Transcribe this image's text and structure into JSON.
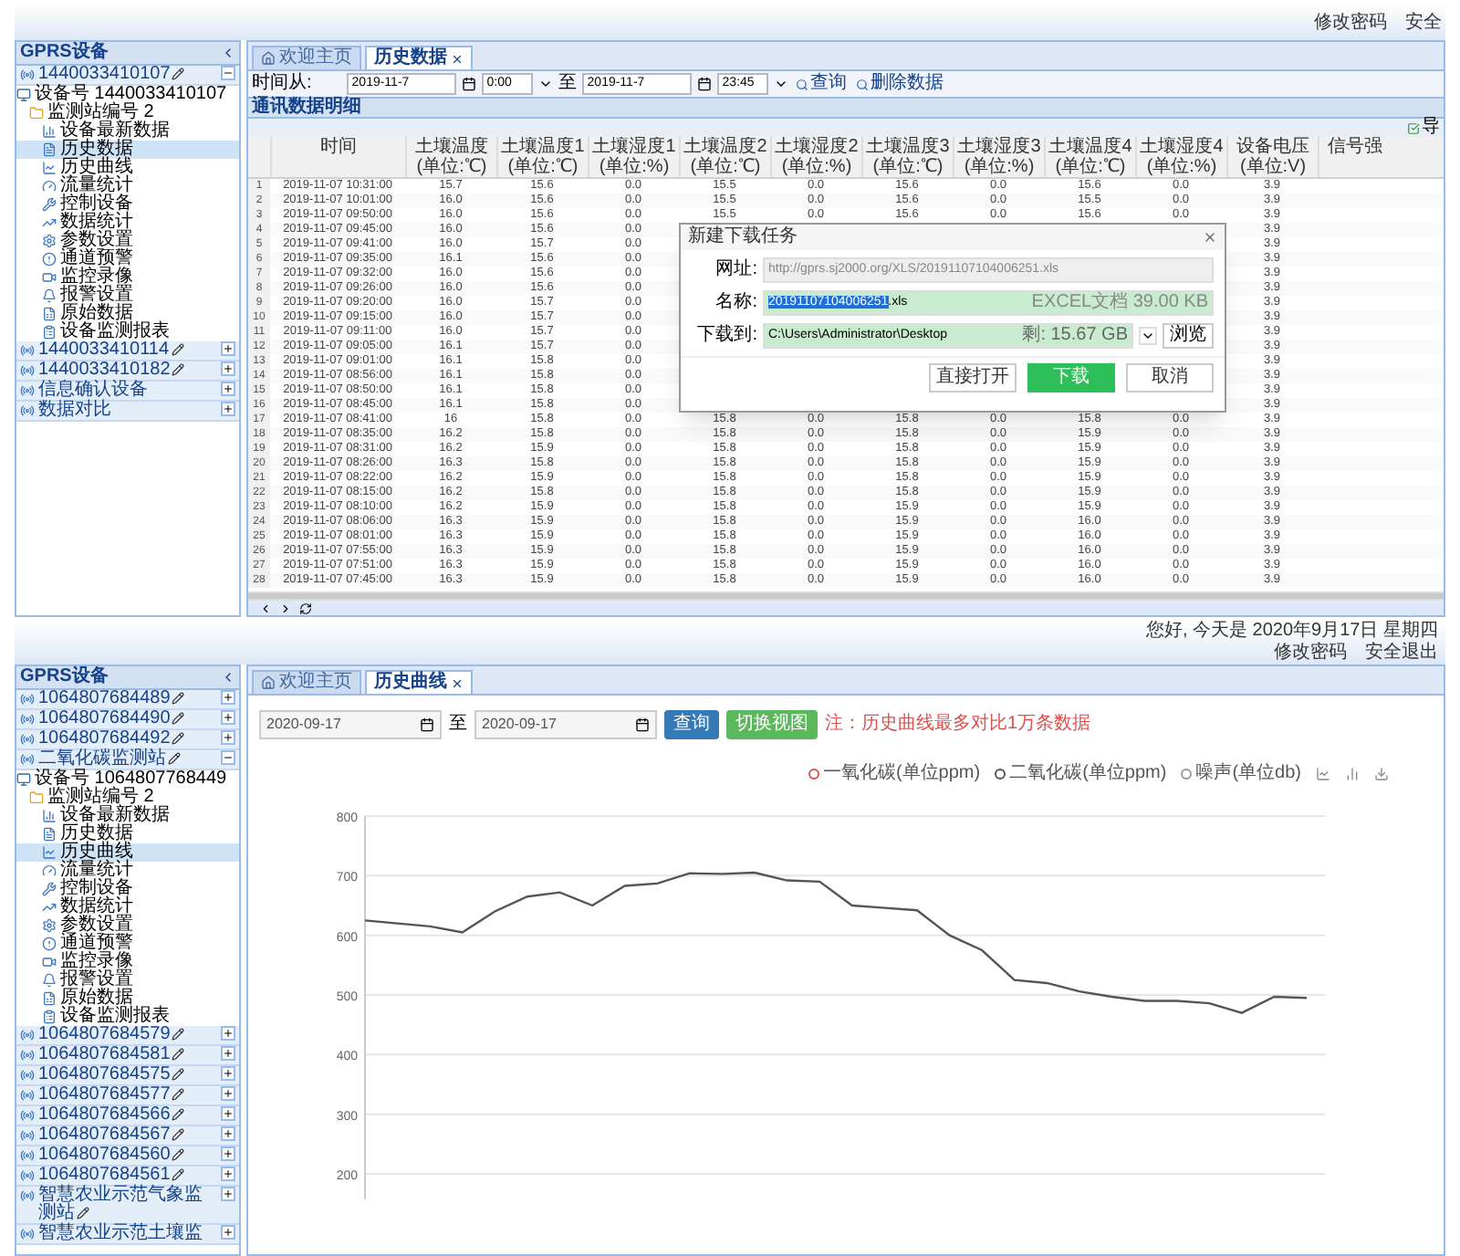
{
  "top": {
    "header_links": [
      "修改密码",
      "安全"
    ],
    "sidebar": {
      "title": "GPRS设备",
      "groups": [
        {
          "label": "1440033410107",
          "editable": true,
          "expanded": true,
          "children": [
            {
              "label": "设备号 1440033410107",
              "children": [
                {
                  "label": "监测站编号 2",
                  "children": [
                    {
                      "label": "设备最新数据",
                      "selected": false
                    },
                    {
                      "label": "历史数据",
                      "selected": true
                    },
                    {
                      "label": "历史曲线",
                      "selected": false
                    },
                    {
                      "label": "流量统计",
                      "selected": false
                    },
                    {
                      "label": "控制设备",
                      "selected": false
                    },
                    {
                      "label": "数据统计",
                      "selected": false
                    },
                    {
                      "label": "参数设置",
                      "selected": false
                    },
                    {
                      "label": "通道预警",
                      "selected": false
                    },
                    {
                      "label": "监控录像",
                      "selected": false
                    },
                    {
                      "label": "报警设置",
                      "selected": false
                    },
                    {
                      "label": "原始数据",
                      "selected": false
                    },
                    {
                      "label": "设备监测报表",
                      "selected": false
                    }
                  ]
                }
              ]
            }
          ]
        },
        {
          "label": "1440033410114",
          "editable": true,
          "expanded": false
        },
        {
          "label": "1440033410182",
          "editable": true,
          "expanded": false
        },
        {
          "label": "信息确认设备",
          "editable": false,
          "expanded": false
        },
        {
          "label": "数据对比",
          "editable": false,
          "expanded": false
        }
      ]
    },
    "tabs": [
      {
        "label": "欢迎主页",
        "selected": false,
        "closable": false
      },
      {
        "label": "历史数据",
        "selected": true,
        "closable": true
      }
    ],
    "toolbar": {
      "from_label": "时间从:",
      "start_date": "2019-11-7",
      "start_time": "0:00",
      "to_label": "至",
      "end_date": "2019-11-7",
      "end_time": "23:45",
      "buttons": [
        "查询",
        "删除数据"
      ]
    },
    "panel_title": "通讯数据明细",
    "export_label": "导",
    "table": {
      "columns": [
        "时间",
        "土壤温度(单位:℃)",
        "土壤温度1(单位:℃)",
        "土壤湿度1(单位:%)",
        "土壤温度2(单位:℃)",
        "土壤湿度2(单位:%)",
        "土壤温度3(单位:℃)",
        "土壤湿度3(单位:%)",
        "土壤温度4(单位:℃)",
        "土壤湿度4(单位:%)",
        "设备电压(单位:V)",
        "信号强"
      ],
      "rows": [
        {
          "n": "1",
          "cells": [
            "2019-11-07 10:31:00",
            "15.7",
            "15.6",
            "0.0",
            "15.5",
            "0.0",
            "15.6",
            "0.0",
            "15.6",
            "0.0",
            "3.9"
          ]
        },
        {
          "n": "2",
          "cells": [
            "2019-11-07 10:01:00",
            "16.0",
            "15.6",
            "0.0",
            "15.5",
            "0.0",
            "15.6",
            "0.0",
            "15.5",
            "0.0",
            "3.9"
          ]
        },
        {
          "n": "3",
          "cells": [
            "2019-11-07 09:50:00",
            "16.0",
            "15.6",
            "0.0",
            "15.5",
            "0.0",
            "15.6",
            "0.0",
            "15.6",
            "0.0",
            "3.9"
          ]
        },
        {
          "n": "4",
          "cells": [
            "2019-11-07 09:45:00",
            "16.0",
            "15.6",
            "0.0"
          ],
          "right_cells": [
            "3.9"
          ]
        },
        {
          "n": "5",
          "cells": [
            "2019-11-07 09:41:00",
            "16.0",
            "15.7",
            "0.0"
          ],
          "right_cells": [
            "3.9"
          ]
        },
        {
          "n": "6",
          "cells": [
            "2019-11-07 09:35:00",
            "16.1",
            "15.6",
            "0.0"
          ],
          "right_cells": [
            "3.9"
          ]
        },
        {
          "n": "7",
          "cells": [
            "2019-11-07 09:32:00",
            "16.0",
            "15.6",
            "0.0"
          ],
          "right_cells": [
            "3.9"
          ]
        },
        {
          "n": "8",
          "cells": [
            "2019-11-07 09:26:00",
            "16.0",
            "15.6",
            "0.0"
          ],
          "right_cells": [
            "3.9"
          ]
        },
        {
          "n": "9",
          "cells": [
            "2019-11-07 09:20:00",
            "16.0",
            "15.7",
            "0.0"
          ],
          "right_cells": [
            "3.9"
          ]
        },
        {
          "n": "10",
          "cells": [
            "2019-11-07 09:15:00",
            "16.0",
            "15.7",
            "0.0"
          ],
          "right_cells": [
            "3.9"
          ]
        },
        {
          "n": "11",
          "cells": [
            "2019-11-07 09:11:00",
            "16.0",
            "15.7",
            "0.0"
          ],
          "right_cells": [
            "3.9"
          ]
        },
        {
          "n": "12",
          "cells": [
            "2019-11-07 09:05:00",
            "16.1",
            "15.7",
            "0.0"
          ],
          "right_cells": [
            "3.9"
          ]
        },
        {
          "n": "13",
          "cells": [
            "2019-11-07 09:01:00",
            "16.1",
            "15.8",
            "0.0"
          ],
          "right_cells": [
            "3.9"
          ]
        },
        {
          "n": "14",
          "cells": [
            "2019-11-07 08:56:00",
            "16.1",
            "15.8",
            "0.0"
          ],
          "right_cells": [
            "3.9"
          ]
        },
        {
          "n": "15",
          "cells": [
            "2019-11-07 08:50:00",
            "16.1",
            "15.8",
            "0.0"
          ],
          "right_cells": [
            "3.9"
          ]
        },
        {
          "n": "16",
          "cells": [
            "2019-11-07 08:45:00",
            "16.1",
            "15.8",
            "0.0"
          ],
          "right_cells": [
            "3.9"
          ]
        },
        {
          "n": "17",
          "cells": [
            "2019-11-07 08:41:00",
            "16",
            "15.8",
            "0.0",
            "15.8",
            "0.0",
            "15.8",
            "0.0",
            "15.8",
            "0.0",
            "3.9"
          ]
        },
        {
          "n": "18",
          "cells": [
            "2019-11-07 08:35:00",
            "16.2",
            "15.8",
            "0.0",
            "15.8",
            "0.0",
            "15.8",
            "0.0",
            "15.9",
            "0.0",
            "3.9"
          ]
        },
        {
          "n": "19",
          "cells": [
            "2019-11-07 08:31:00",
            "16.2",
            "15.9",
            "0.0",
            "15.8",
            "0.0",
            "15.8",
            "0.0",
            "15.9",
            "0.0",
            "3.9"
          ]
        },
        {
          "n": "20",
          "cells": [
            "2019-11-07 08:26:00",
            "16.3",
            "15.8",
            "0.0",
            "15.8",
            "0.0",
            "15.8",
            "0.0",
            "15.9",
            "0.0",
            "3.9"
          ]
        },
        {
          "n": "21",
          "cells": [
            "2019-11-07 08:22:00",
            "16.2",
            "15.9",
            "0.0",
            "15.8",
            "0.0",
            "15.8",
            "0.0",
            "15.9",
            "0.0",
            "3.9"
          ]
        },
        {
          "n": "22",
          "cells": [
            "2019-11-07 08:15:00",
            "16.2",
            "15.8",
            "0.0",
            "15.8",
            "0.0",
            "15.8",
            "0.0",
            "15.9",
            "0.0",
            "3.9"
          ]
        },
        {
          "n": "23",
          "cells": [
            "2019-11-07 08:10:00",
            "16.2",
            "15.9",
            "0.0",
            "15.8",
            "0.0",
            "15.9",
            "0.0",
            "15.9",
            "0.0",
            "3.9"
          ]
        },
        {
          "n": "24",
          "cells": [
            "2019-11-07 08:06:00",
            "16.3",
            "15.9",
            "0.0",
            "15.8",
            "0.0",
            "15.9",
            "0.0",
            "16.0",
            "0.0",
            "3.9"
          ]
        },
        {
          "n": "25",
          "cells": [
            "2019-11-07 08:01:00",
            "16.3",
            "15.9",
            "0.0",
            "15.8",
            "0.0",
            "15.9",
            "0.0",
            "16.0",
            "0.0",
            "3.9"
          ]
        },
        {
          "n": "26",
          "cells": [
            "2019-11-07 07:55:00",
            "16.3",
            "15.9",
            "0.0",
            "15.8",
            "0.0",
            "15.9",
            "0.0",
            "16.0",
            "0.0",
            "3.9"
          ]
        },
        {
          "n": "27",
          "cells": [
            "2019-11-07 07:51:00",
            "16.3",
            "15.9",
            "0.0",
            "15.8",
            "0.0",
            "15.9",
            "0.0",
            "16.0",
            "0.0",
            "3.9"
          ]
        },
        {
          "n": "28",
          "cells": [
            "2019-11-07 07:45:00",
            "16.3",
            "15.9",
            "0.0",
            "15.8",
            "0.0",
            "15.9",
            "0.0",
            "16.0",
            "0.0",
            "3.9"
          ]
        }
      ]
    },
    "dialog": {
      "title": "新建下载任务",
      "url_label": "网址:",
      "url": "http://gprs.sj2000.org/XLS/20191107104006251.xls",
      "name_label": "名称:",
      "file_name": "20191107104006251",
      "file_ext": ".xls",
      "file_type": "EXCEL文档 39.00 KB",
      "dest_label": "下载到:",
      "dest": "C:\\Users\\Administrator\\Desktop",
      "free_space": "剩: 15.67 GB",
      "browse": "浏览",
      "buttons": [
        {
          "label": "直接打开",
          "kind": "default"
        },
        {
          "label": "下载",
          "kind": "primary"
        },
        {
          "label": "取消",
          "kind": "default"
        }
      ]
    }
  },
  "bottom": {
    "greeting": "您好, 今天是 2020年9月17日 星期四",
    "header_links": [
      "修改密码",
      "安全退出"
    ],
    "sidebar": {
      "title": "GPRS设备",
      "groups": [
        {
          "label": "1064807684489",
          "editable": true,
          "expanded": false
        },
        {
          "label": "1064807684490",
          "editable": true,
          "expanded": false
        },
        {
          "label": "1064807684492",
          "editable": true,
          "expanded": false
        },
        {
          "label": "二氧化碳监测站",
          "editable": true,
          "expanded": true,
          "children": [
            {
              "label": "设备号 1064807768449",
              "children": [
                {
                  "label": "监测站编号 2",
                  "children": [
                    {
                      "label": "设备最新数据",
                      "selected": false
                    },
                    {
                      "label": "历史数据",
                      "selected": false
                    },
                    {
                      "label": "历史曲线",
                      "selected": true
                    },
                    {
                      "label": "流量统计",
                      "selected": false
                    },
                    {
                      "label": "控制设备",
                      "selected": false
                    },
                    {
                      "label": "数据统计",
                      "selected": false
                    },
                    {
                      "label": "参数设置",
                      "selected": false
                    },
                    {
                      "label": "通道预警",
                      "selected": false
                    },
                    {
                      "label": "监控录像",
                      "selected": false
                    },
                    {
                      "label": "报警设置",
                      "selected": false
                    },
                    {
                      "label": "原始数据",
                      "selected": false
                    },
                    {
                      "label": "设备监测报表",
                      "selected": false
                    }
                  ]
                }
              ]
            }
          ]
        },
        {
          "label": "1064807684579",
          "editable": true,
          "expanded": false
        },
        {
          "label": "1064807684581",
          "editable": true,
          "expanded": false
        },
        {
          "label": "1064807684575",
          "editable": true,
          "expanded": false
        },
        {
          "label": "1064807684577",
          "editable": true,
          "expanded": false
        },
        {
          "label": "1064807684566",
          "editable": true,
          "expanded": false
        },
        {
          "label": "1064807684567",
          "editable": true,
          "expanded": false
        },
        {
          "label": "1064807684560",
          "editable": true,
          "expanded": false
        },
        {
          "label": "1064807684561",
          "editable": true,
          "expanded": false
        },
        {
          "label": "智慧农业示范气象监测站",
          "editable": true,
          "expanded": false
        },
        {
          "label": "智慧农业示范土壤监",
          "editable": false,
          "expanded": false
        }
      ]
    },
    "tabs": [
      {
        "label": "欢迎主页",
        "selected": false,
        "closable": false
      },
      {
        "label": "历史曲线",
        "selected": true,
        "closable": true
      }
    ],
    "start_date": "2020-09-17",
    "to_label": "至",
    "end_date": "2020-09-17",
    "buttons": [
      {
        "label": "查询",
        "kind": "primary"
      },
      {
        "label": "切换视图",
        "kind": "success"
      }
    ],
    "note": "注：历史曲线最多对比1万条数据",
    "chart_data": {
      "type": "line",
      "grid": true,
      "ylim": [
        200,
        800
      ],
      "yticks": [
        200,
        300,
        400,
        500,
        600,
        700,
        800
      ],
      "series": [
        {
          "name": "一氧化碳(单位ppm)",
          "color": "#d9534f"
        },
        {
          "name": "二氧化碳(单位ppm)",
          "color": "#555555",
          "values": [
            625,
            620,
            615,
            605,
            640,
            665,
            672,
            650,
            683,
            687,
            704,
            703,
            705,
            692,
            690,
            650,
            646,
            642,
            600,
            575,
            525,
            520,
            506,
            497,
            490,
            490,
            486,
            470,
            497,
            495
          ]
        },
        {
          "name": "噪声(单位db)",
          "color": "#999999"
        }
      ]
    }
  }
}
